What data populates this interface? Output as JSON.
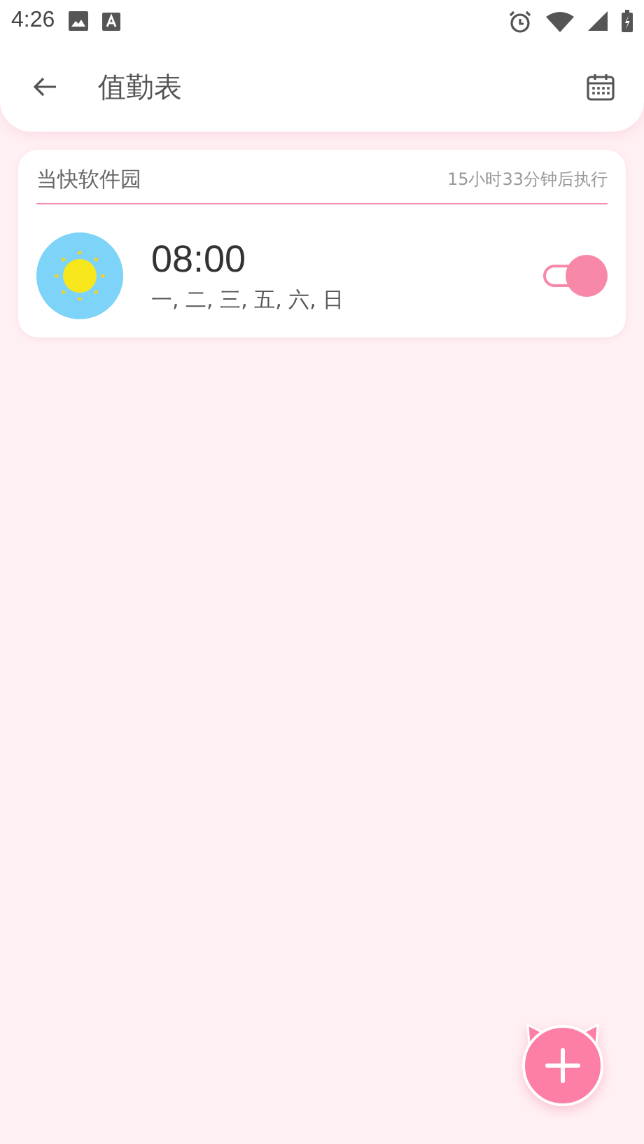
{
  "status_bar": {
    "time": "4:26"
  },
  "app_bar": {
    "title": "值勤表"
  },
  "alarms": [
    {
      "group": "当快软件园",
      "countdown": "15小时33分钟后执行",
      "time": "08:00",
      "days": "一, 二, 三, 五, 六, 日",
      "on": true
    }
  ]
}
